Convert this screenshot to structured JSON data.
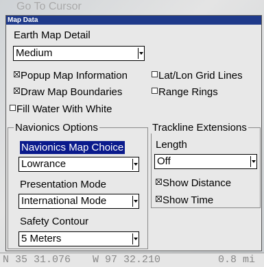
{
  "background": {
    "ghost_menu": "Go To Cursor",
    "status": {
      "lat": "N  35 31.076",
      "lon": "W  97 32.210",
      "dist": "0.8 mi"
    }
  },
  "dialog": {
    "title": "Map Data",
    "earth_map_detail": {
      "label": "Earth Map Detail",
      "value": "Medium"
    },
    "checkboxes": {
      "popup_map_information": {
        "label": "Popup Map Information",
        "checked": true
      },
      "lat_lon_grid_lines": {
        "label": "Lat/Lon Grid Lines",
        "checked": false
      },
      "draw_map_boundaries": {
        "label": "Draw Map Boundaries",
        "checked": true
      },
      "range_rings": {
        "label": "Range Rings",
        "checked": false
      },
      "fill_water_with_white": {
        "label": "Fill Water With White",
        "checked": false
      }
    },
    "navionics": {
      "title": "Navionics Options",
      "map_choice": {
        "label": "Navionics Map Choice",
        "value": "Lowrance"
      },
      "presentation_mode": {
        "label": "Presentation Mode",
        "value": "International Mode"
      },
      "safety_contour": {
        "label": "Safety Contour",
        "value": "5 Meters"
      }
    },
    "trackline": {
      "title": "Trackline Extensions",
      "length": {
        "label": "Length",
        "value": "Off"
      },
      "show_distance": {
        "label": "Show Distance",
        "checked": true
      },
      "show_time": {
        "label": "Show Time",
        "checked": true
      }
    }
  }
}
